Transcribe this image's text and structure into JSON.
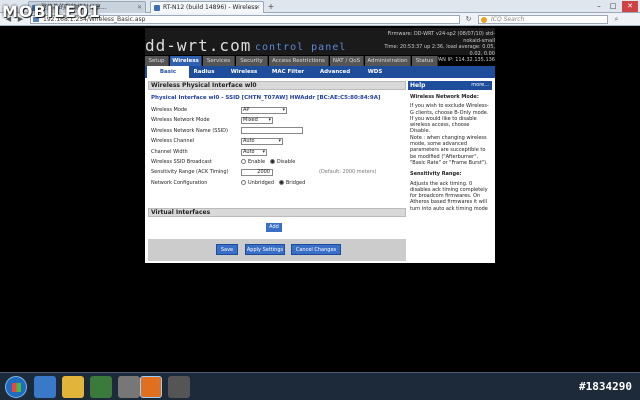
{
  "logo": {
    "text": "MOBILE01"
  },
  "browser": {
    "tabs": [
      {
        "label": "登錄為的動物統計分享..."
      },
      {
        "label": "RT-N12 (build 14896) - Wireless"
      }
    ],
    "url": "192.168.1.254/Wireless_Basic.asp",
    "search_placeholder": "ICQ Search"
  },
  "ddwrt": {
    "logo": "dd-wrt.com",
    "subtitle": "control panel",
    "firmware": "Firmware: DD-WRT v24-sp2 (08/07/10) std-nokaid-small",
    "time": "Time: 20:53:37 up 2:36, load average: 0.05, 0.02, 0.00",
    "wan": "WAN IP: 114.32.135.136"
  },
  "main_tabs": [
    "Setup",
    "Wireless",
    "Services",
    "Security",
    "Access Restrictions",
    "NAT / QoS",
    "Administration",
    "Status"
  ],
  "sub_tabs": [
    "Basic Settings",
    "Radius",
    "Wireless Security",
    "MAC Filter",
    "Advanced Settings",
    "WDS"
  ],
  "section": {
    "title": "Wireless Physical Interface wl0",
    "iface": "Physical Interface wl0 - SSID [CHTN_T07AW] HWAddr [BC:AE:C5:80:84:9A]"
  },
  "fields": {
    "mode_label": "Wireless Mode",
    "mode_value": "AP",
    "netmode_label": "Wireless Network Mode",
    "netmode_value": "Mixed",
    "ssid_label": "Wireless Network Name (SSID)",
    "ssid_value": "",
    "channel_label": "Wireless Channel",
    "channel_value": "Auto",
    "width_label": "Channel Width",
    "width_value": "Auto",
    "broadcast_label": "Wireless SSID Broadcast",
    "enable": "Enable",
    "disable": "Disable",
    "sensitivity_label": "Sensitivity Range (ACK Timing)",
    "sensitivity_value": "2000",
    "sensitivity_hint": "(Default: 2000 meters)",
    "netconf_label": "Network Configuration",
    "unbridged": "Unbridged",
    "bridged": "Bridged"
  },
  "virtual": {
    "title": "Virtual Interfaces",
    "add": "Add"
  },
  "buttons": {
    "save": "Save",
    "apply": "Apply Settings",
    "cancel": "Cancel Changes"
  },
  "help": {
    "title": "Help",
    "more": "more...",
    "t1": "Wireless Network Mode:",
    "b1": "If you wish to exclude Wireless-G clients, choose B-Only mode. If you would like to disable wireless access, choose Disable.",
    "b1note": "Note : when changing wireless mode, some advanced parameters are succeptible to be modified (\"Afterburner\", \"Basic Rate\" or \"Frame Burst\").",
    "t2": "Sensitivity Range:",
    "b2": "Adjusts the ack timing. 0 disables ack timing completely for broadcom firmwares. On Atheros based firmwares it will turn into auto ack timing mode"
  },
  "taskbar": {
    "watermark": "#1834290"
  }
}
